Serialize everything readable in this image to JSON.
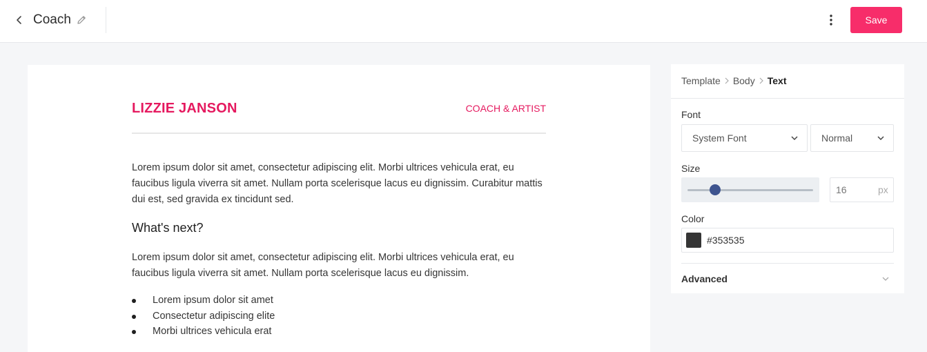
{
  "topbar": {
    "title": "Coach",
    "back_icon": "chevron-left-icon",
    "edit_icon": "pencil-icon",
    "more_icon": "more-vertical-icon",
    "save_label": "Save",
    "accent_color": "#f72d6a"
  },
  "email": {
    "name": "LIZZIE JANSON",
    "role": "COACH & ARTIST",
    "brand_color": "#e5195f",
    "paragraph_1": "Lorem ipsum dolor sit amet, consectetur adipiscing elit. Morbi ultrices vehicula erat, eu faucibus ligula viverra sit amet. Nullam porta scelerisque lacus eu dignissim. Curabitur mattis dui est, sed gravida ex tincidunt sed.",
    "heading": "What's next?",
    "paragraph_2": "Lorem ipsum dolor sit amet, consectetur adipiscing elit. Morbi ultrices vehicula erat, eu faucibus ligula viverra sit amet. Nullam porta scelerisque lacus eu dignissim.",
    "bullets": [
      "Lorem ipsum dolor sit amet",
      "Consectetur adipiscing elite",
      "Morbi ultrices vehicula erat"
    ]
  },
  "panel": {
    "breadcrumb": [
      "Template",
      "Body",
      "Text"
    ],
    "font_label": "Font",
    "font_family": "System Font",
    "font_weight": "Normal",
    "size_label": "Size",
    "size_value": "16",
    "size_unit": "px",
    "color_label": "Color",
    "color_value": "#353535",
    "advanced_label": "Advanced"
  }
}
